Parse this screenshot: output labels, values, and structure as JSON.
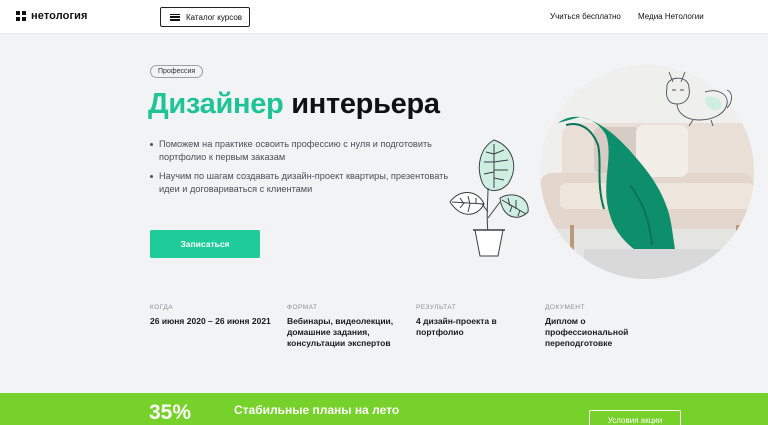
{
  "header": {
    "logo_text": "нетология",
    "catalog_label": "Каталог курсов",
    "nav_learn": "Учиться бесплатно",
    "nav_media": "Медиа Нетологии"
  },
  "hero": {
    "badge": "Профессия",
    "title_accent": "Дизайнер",
    "title_rest": "интерьера",
    "bullets": [
      "Поможем на практике освоить профессию с нуля и подготовить портфолио к первым заказам",
      "Научим по шагам создавать дизайн-проект квартиры, презентовать идеи и договариваться с клиентами"
    ],
    "cta_label": "Записаться"
  },
  "info": [
    {
      "label": "КОГДА",
      "value": "26 июня 2020 – 26 июня 2021"
    },
    {
      "label": "ФОРМАТ",
      "value": "Вебинары, видеолекции, домашние задания, консультации экспертов"
    },
    {
      "label": "РЕЗУЛЬТАТ",
      "value": "4 дизайн-проекта в портфолио"
    },
    {
      "label": "ДОКУМЕНТ",
      "value": "Диплом о профессиональной переподготовке"
    }
  ],
  "promo": {
    "percent": "35%",
    "text": "Стабильные планы на лето",
    "button_label": "Условия акции"
  },
  "colors": {
    "accent": "#1fc496",
    "cta": "#1fcc99",
    "promo": "#76d12a",
    "background": "#f2f3f5"
  },
  "icons": [
    "logo-mark-icon",
    "burger-menu-icon",
    "plant-illustration",
    "cat-illustration",
    "sofa-photo"
  ]
}
